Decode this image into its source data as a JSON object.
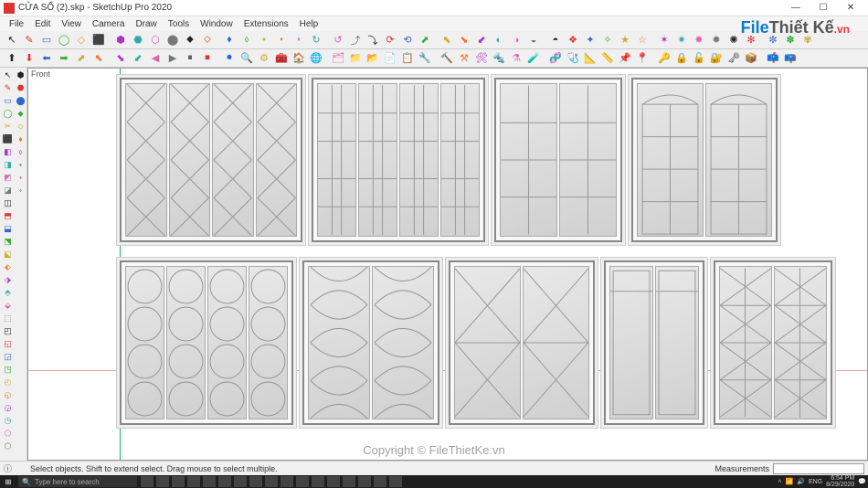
{
  "titlebar": {
    "title": "CỬA SỔ (2).skp - SketchUp Pro 2020"
  },
  "menu": {
    "items": [
      "File",
      "Edit",
      "View",
      "Camera",
      "Draw",
      "Tools",
      "Window",
      "Extensions",
      "Help"
    ]
  },
  "view_label": "Front",
  "watermark": {
    "logo_1": "File",
    "logo_2": "Thiết Kế",
    "logo_3": ".vn",
    "center": "Copyright © FileThietKe.vn"
  },
  "status": {
    "hint": "Select objects. Shift to extend select. Drag mouse to select multiple.",
    "meas_label": "Measurements"
  },
  "taskbar": {
    "search_placeholder": "Type here to search",
    "lang": "ENG",
    "time": "6:54 PM",
    "date": "8/29/2020"
  },
  "toolbar_icons_row1": [
    "↖",
    "✎",
    "▭",
    "◯",
    "◇",
    "⬛",
    "⬢",
    "⬣",
    "⬡",
    "⬤",
    "⬥",
    "⬦",
    "⬧",
    "⬨",
    "⬩",
    "⬪",
    "⬫",
    "↻",
    "↺",
    "⤴",
    "⤵",
    "⟳",
    "⟲",
    "⬈",
    "⬉",
    "⬊",
    "⬋",
    "◐",
    "◑",
    "◒",
    "◓",
    "❖",
    "✦",
    "✧",
    "★",
    "☆",
    "✶",
    "✷",
    "✸",
    "✹",
    "✺",
    "✻",
    "✼",
    "✽",
    "✾"
  ],
  "toolbar_icons_row2": [
    "⬆",
    "⬇",
    "⬅",
    "➡",
    "⬈",
    "⬉",
    "⬊",
    "⬋",
    "◀",
    "▶",
    "⏸",
    "⏹",
    "⏺",
    "🔍",
    "⚙",
    "🧰",
    "🏠",
    "🌐",
    "🗂",
    "📁",
    "📂",
    "📄",
    "📋",
    "🔧",
    "🔨",
    "⚒",
    "🛠",
    "🔩",
    "⚗",
    "🧪",
    "🧬",
    "🩺",
    "📐",
    "📏",
    "📌",
    "📍",
    "🔑",
    "🔒",
    "🔓",
    "🔐",
    "🗝",
    "📦",
    "📫",
    "📪"
  ],
  "left_tools": [
    "↖",
    "✎",
    "▭",
    "◯",
    "✂",
    "⬛",
    "◧",
    "◨",
    "◩",
    "◪",
    "◫",
    "⬒",
    "⬓",
    "⬔",
    "⬕",
    "⬖",
    "⬗",
    "⬘",
    "⬙",
    "⬚",
    "◰",
    "◱",
    "◲",
    "◳",
    "◴",
    "◵",
    "◶",
    "◷",
    "⬠",
    "⬡",
    "⬢",
    "⬣",
    "⬤",
    "⬥",
    "⬦",
    "⬧",
    "⬨",
    "⬩",
    "⬪",
    "⬫"
  ]
}
